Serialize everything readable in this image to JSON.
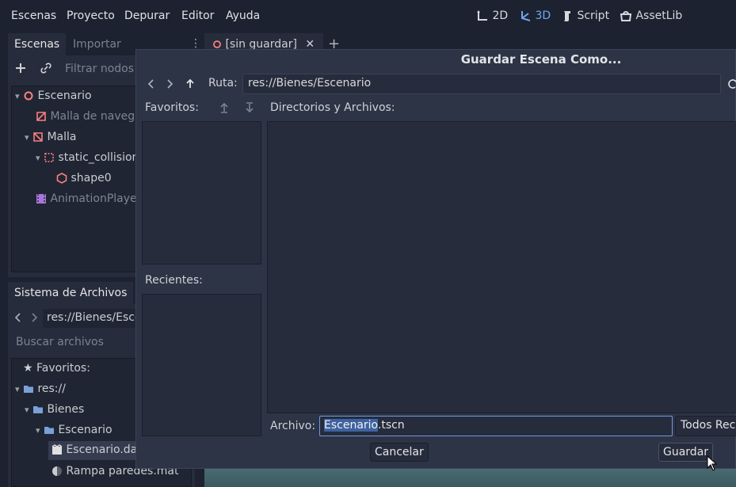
{
  "menubar": {
    "items": [
      "Escenas",
      "Proyecto",
      "Depurar",
      "Editor",
      "Ayuda"
    ],
    "workspaces": [
      {
        "label": "2D",
        "icon": "2d-icon",
        "active": false
      },
      {
        "label": "3D",
        "icon": "3d-icon",
        "active": true
      },
      {
        "label": "Script",
        "icon": "script-icon",
        "active": false
      },
      {
        "label": "AssetLib",
        "icon": "assetlib-icon",
        "active": false
      }
    ]
  },
  "scene_dock": {
    "tabs": [
      "Escenas",
      "Importar"
    ],
    "filter_placeholder": "Filtrar nodos",
    "tree": [
      {
        "label": "Escenario",
        "icon": "node3d-icon",
        "depth": 0
      },
      {
        "label": "Malla de navegación",
        "icon": "navmesh-icon",
        "depth": 1
      },
      {
        "label": "Malla",
        "icon": "mesh-icon",
        "depth": 1
      },
      {
        "label": "static_collision",
        "icon": "static-body-icon",
        "depth": 2
      },
      {
        "label": "shape0",
        "icon": "collision-shape-icon",
        "depth": 3
      },
      {
        "label": "AnimationPlayer",
        "icon": "animation-player-icon",
        "depth": 1
      }
    ]
  },
  "editor_tabs": {
    "scene_tab": "[sin guardar]"
  },
  "filesystem_dock": {
    "title": "Sistema de Archivos",
    "path": "res://Bienes/Escenario",
    "search_placeholder": "Buscar archivos",
    "tree": [
      {
        "label": "Favoritos:",
        "icon": "star-icon"
      },
      {
        "label": "res://",
        "icon": "folder-icon"
      },
      {
        "label": "Bienes",
        "icon": "folder-icon"
      },
      {
        "label": "Escenario",
        "icon": "folder-icon"
      },
      {
        "label": "Escenario.dae",
        "icon": "scene-file-icon"
      },
      {
        "label": "Rampa paredes.mat",
        "icon": "material-icon"
      }
    ]
  },
  "dialog": {
    "title": "Guardar Escena Como...",
    "path_label": "Ruta:",
    "path_value": "res://Bienes/Escenario",
    "favorites_label": "Favoritos:",
    "recents_label": "Recientes:",
    "dirs_label": "Directorios y Archivos:",
    "file_label": "Archivo:",
    "file_selected": "Escenario",
    "file_ext": ".tscn",
    "filter_value": "Todos Reconocidos",
    "cancel_label": "Cancelar",
    "save_label": "Guardar"
  }
}
